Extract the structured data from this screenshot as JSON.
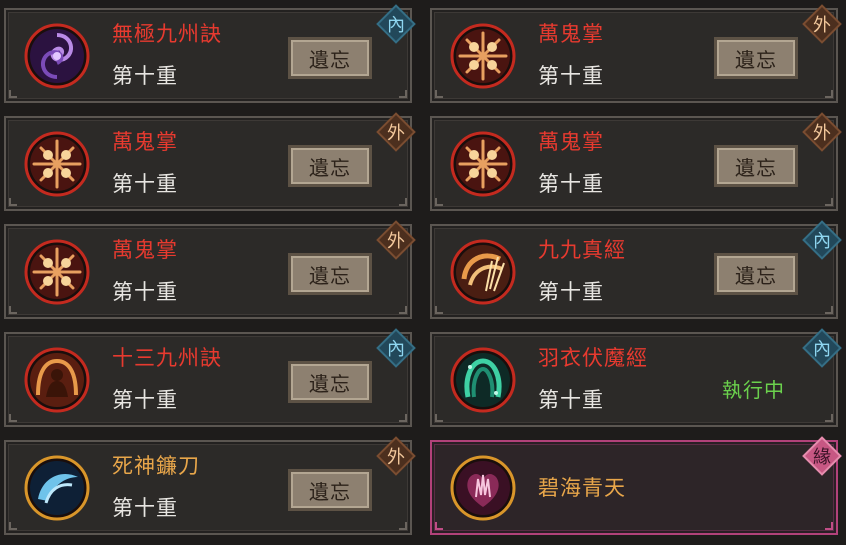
{
  "skills": [
    {
      "name": "無極九州訣",
      "name_color": "#e83a2f",
      "level": "第十重",
      "action": "遺忘",
      "type": "內",
      "type_kind": "inner",
      "icon": "vortex-icon"
    },
    {
      "name": "萬鬼掌",
      "name_color": "#e83a2f",
      "level": "第十重",
      "action": "遺忘",
      "type": "外",
      "type_kind": "outer",
      "icon": "ghost-palm-icon"
    },
    {
      "name": "萬鬼掌",
      "name_color": "#e83a2f",
      "level": "第十重",
      "action": "遺忘",
      "type": "外",
      "type_kind": "outer",
      "icon": "ghost-palm-icon"
    },
    {
      "name": "萬鬼掌",
      "name_color": "#e83a2f",
      "level": "第十重",
      "action": "遺忘",
      "type": "外",
      "type_kind": "outer",
      "icon": "ghost-palm-icon"
    },
    {
      "name": "萬鬼掌",
      "name_color": "#e83a2f",
      "level": "第十重",
      "action": "遺忘",
      "type": "外",
      "type_kind": "outer",
      "icon": "ghost-palm-icon"
    },
    {
      "name": "九九真經",
      "name_color": "#e83a2f",
      "level": "第十重",
      "action": "遺忘",
      "type": "內",
      "type_kind": "inner",
      "icon": "swirl-strike-icon"
    },
    {
      "name": "十三九州訣",
      "name_color": "#e83a2f",
      "level": "第十重",
      "action": "遺忘",
      "type": "內",
      "type_kind": "inner",
      "icon": "meditation-icon"
    },
    {
      "name": "羽衣伏魔經",
      "name_color": "#e83a2f",
      "level": "第十重",
      "status": "執行中",
      "type": "內",
      "type_kind": "inner",
      "icon": "green-shroud-icon"
    },
    {
      "name": "死神鐮刀",
      "name_color": "#e8a64a",
      "level": "第十重",
      "action": "遺忘",
      "type": "外",
      "type_kind": "outer",
      "icon": "scythe-icon"
    },
    {
      "name": "碧海青天",
      "name_color": "#e8a64a",
      "type": "緣",
      "type_kind": "fate",
      "icon": "crystal-heart-icon"
    }
  ],
  "colors": {
    "red_name": "#e83a2f",
    "orange_name": "#e8a64a",
    "active_status": "#6bd14d",
    "fate_border": "#b2427a"
  }
}
